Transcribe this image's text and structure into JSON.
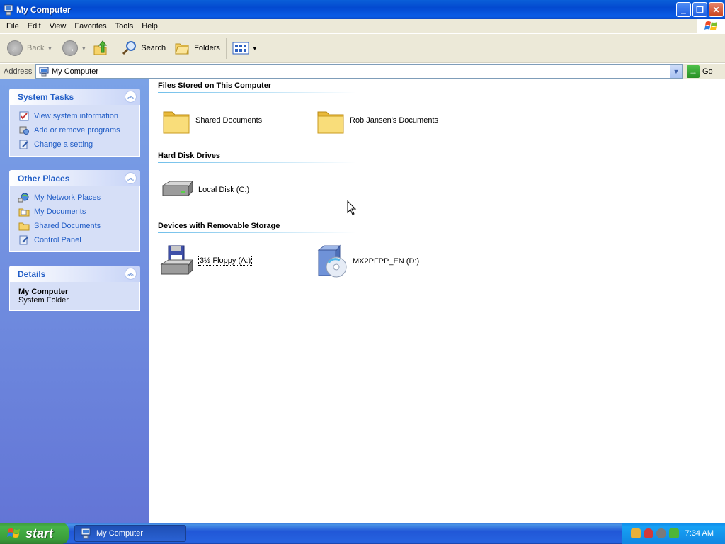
{
  "window": {
    "title": "My Computer",
    "minimize": "_",
    "restore": "❐",
    "close": "✕"
  },
  "menu": [
    "File",
    "Edit",
    "View",
    "Favorites",
    "Tools",
    "Help"
  ],
  "toolbar": {
    "back_label": "Back",
    "search_label": "Search",
    "folders_label": "Folders"
  },
  "address": {
    "label": "Address",
    "value": "My Computer",
    "go_label": "Go"
  },
  "sidebar": {
    "system_tasks": {
      "title": "System Tasks",
      "items": [
        "View system information",
        "Add or remove programs",
        "Change a setting"
      ]
    },
    "other_places": {
      "title": "Other Places",
      "items": [
        "My Network Places",
        "My Documents",
        "Shared Documents",
        "Control Panel"
      ]
    },
    "details": {
      "title": "Details",
      "name": "My Computer",
      "type": "System Folder"
    }
  },
  "main": {
    "groups": [
      {
        "title": "Files Stored on This Computer",
        "items": [
          "Shared Documents",
          "Rob Jansen's Documents"
        ]
      },
      {
        "title": "Hard Disk Drives",
        "items": [
          "Local Disk (C:)"
        ]
      },
      {
        "title": "Devices with Removable Storage",
        "items": [
          "3½ Floppy (A:)",
          "MX2PFPP_EN (D:)"
        ]
      }
    ]
  },
  "taskbar": {
    "start_label": "start",
    "task_label": "My Computer",
    "clock": "7:34 AM"
  },
  "colors": {
    "title_blue": "#0a5ce6",
    "link_blue": "#215dc6",
    "panel_bg": "#d6dff7",
    "start_green": "#3a9c3a"
  }
}
